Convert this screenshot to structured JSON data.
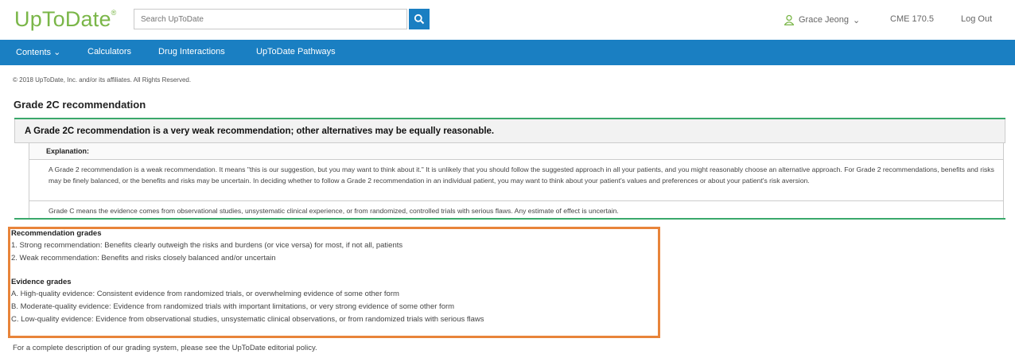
{
  "header": {
    "logo": "UpToDate",
    "logo_mark": "®",
    "search_placeholder": "Search UpToDate",
    "user_name": "Grace Jeong",
    "user_caret": "⌄",
    "cme": "CME 170.5",
    "logout": "Log Out"
  },
  "nav": {
    "contents": "Contents ⌄",
    "calculators": "Calculators",
    "drug_interactions": "Drug Interactions",
    "pathways": "UpToDate Pathways"
  },
  "copyright": "© 2018 UpToDate, Inc. and/or its affiliates. All Rights Reserved.",
  "page_title": "Grade 2C recommendation",
  "recommendation": {
    "headline": "A Grade 2C recommendation is a very weak recommendation; other alternatives may be equally reasonable.",
    "explanation_label": "Explanation:",
    "explanation_p1": "A Grade 2 recommendation is a weak recommendation. It means \"this is our suggestion, but you may want to think about it.\" It is unlikely that you should follow the suggested approach in all your patients, and you might reasonably choose an alternative approach. For Grade 2 recommendations, benefits and risks may be finely balanced, or the benefits and risks may be uncertain. In deciding whether to follow a Grade 2 recommendation in an individual patient, you may want to think about your patient's values and preferences or about your patient's risk aversion.",
    "explanation_p2": "Grade C means the evidence comes from observational studies, unsystematic clinical experience, or from randomized, controlled trials with serious flaws. Any estimate of effect is uncertain."
  },
  "grades": {
    "rec_title": "Recommendation grades",
    "rec_items": [
      "1. Strong recommendation: Benefits clearly outweigh the risks and burdens (or vice versa) for most, if not all, patients",
      "2. Weak recommendation: Benefits and risks closely balanced and/or uncertain"
    ],
    "evidence_title": "Evidence grades",
    "evidence_items": [
      "A. High-quality evidence: Consistent evidence from randomized trials, or overwhelming evidence of some other form",
      "B. Moderate-quality evidence: Evidence from randomized trials with important limitations, or very strong evidence of some other form",
      "C. Low-quality evidence: Evidence from observational studies, unsystematic clinical observations, or from randomized trials with serious flaws"
    ]
  },
  "footer": "For a complete description of our grading system, please see the UpToDate editorial policy.",
  "colors": {
    "brand_green": "#7ab648",
    "nav_blue": "#1a7fc2",
    "rule_green": "#3aa86b",
    "highlight_orange": "#e8843a"
  },
  "icons": {
    "search": "search-icon",
    "user": "user-icon"
  }
}
